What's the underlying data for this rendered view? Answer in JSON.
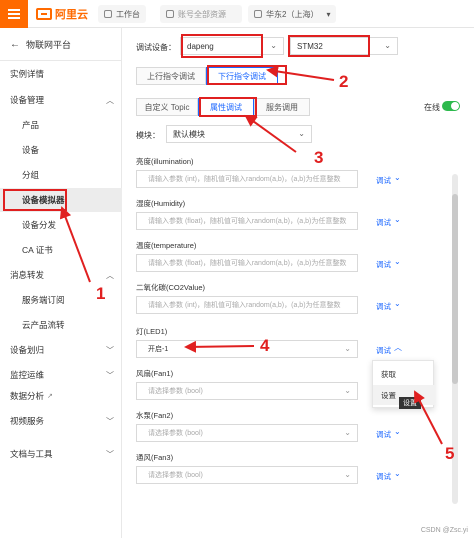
{
  "topbar": {
    "logo_text": "阿里云",
    "workbench": "工作台",
    "account_resources": "账号全部资源",
    "region": "华东2（上海）"
  },
  "sidebar": {
    "title": "物联网平台",
    "items": [
      {
        "label": "实例详情"
      },
      {
        "label": "设备管理"
      },
      {
        "label": "产品"
      },
      {
        "label": "设备"
      },
      {
        "label": "分组"
      },
      {
        "label": "设备模拟器"
      },
      {
        "label": "设备分发"
      },
      {
        "label": "CA 证书"
      },
      {
        "label": "消息转发"
      },
      {
        "label": "服务端订阅"
      },
      {
        "label": "云产品流转"
      },
      {
        "label": "设备划归"
      },
      {
        "label": "监控运维"
      },
      {
        "label": "数据分析"
      },
      {
        "label": "视频服务"
      },
      {
        "label": "文档与工具"
      }
    ]
  },
  "debug": {
    "device_label": "调试设备：",
    "device_value": "dapeng",
    "product_value": "STM32",
    "tabs": [
      "上行指令调试",
      "下行指令调试"
    ],
    "subtabs": [
      "自定义 Topic",
      "属性调试",
      "服务调用"
    ],
    "online_label": "在线",
    "module_label": "模块：",
    "module_value": "默认模块"
  },
  "fields": [
    {
      "label": "亮度(illumination)",
      "placeholder": "请输入参数 (int)，随机值可输入random(a,b)，(a,b)为任意整数"
    },
    {
      "label": "湿度(Humidity)",
      "placeholder": "请输入参数 (float)，随机值可输入random(a,b)，(a,b)为任意整数"
    },
    {
      "label": "温度(temperature)",
      "placeholder": "请输入参数 (float)，随机值可输入random(a,b)，(a,b)为任意整数"
    },
    {
      "label": "二氧化碳(CO2Value)",
      "placeholder": "请输入参数 (int)，随机值可输入random(a,b)，(a,b)为任意整数"
    },
    {
      "label": "灯(LED1)",
      "value": "开启-1"
    },
    {
      "label": "风扇(Fan1)",
      "placeholder": "请选择参数 (bool)"
    },
    {
      "label": "水泵(Fan2)",
      "placeholder": "请选择参数 (bool)"
    },
    {
      "label": "通风(Fan3)",
      "placeholder": "请选择参数 (bool)"
    }
  ],
  "debug_link": "调试",
  "dropdown": {
    "items": [
      "获取",
      "设置"
    ],
    "tooltip": "设置"
  },
  "annotations": [
    "1",
    "2",
    "3",
    "4",
    "5"
  ],
  "watermark": "CSDN @Zsc.yi",
  "colors": {
    "accent": "#ff6a00",
    "primary": "#1a66ff",
    "annotation": "#e02020",
    "online": "#2db94d"
  }
}
